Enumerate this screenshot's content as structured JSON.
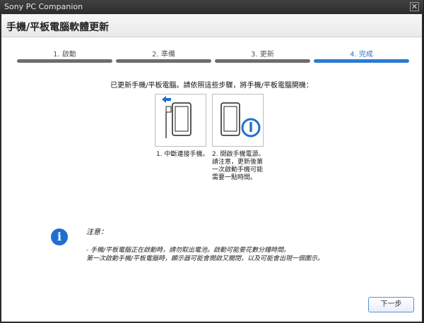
{
  "window": {
    "title": "Sony PC Companion",
    "close_label": "✕"
  },
  "header": {
    "title": "手機/平板電腦軟體更新"
  },
  "steps": [
    {
      "label": "1. 啟動",
      "state": "done"
    },
    {
      "label": "2. 準備",
      "state": "done"
    },
    {
      "label": "3. 更新",
      "state": "done"
    },
    {
      "label": "4. 完成",
      "state": "active"
    }
  ],
  "instruction": "已更新手機/平板電腦。請依照這些步驟，將手機/平板電腦開機：",
  "cards": [
    {
      "icon": "disconnect-cable-icon",
      "caption_lines": [
        "1. 中斷連接手機。"
      ]
    },
    {
      "icon": "power-on-icon",
      "caption_lines": [
        "2. 開啟手機電源。",
        "請注意，更新後第",
        "一次啟動手機可能",
        "需要一點時間。"
      ]
    }
  ],
  "note": {
    "icon": "info-icon",
    "title": "注意：",
    "lines": [
      "- 手機/平板電腦正在啟動時，請勿取出電池。啟動可能要花數分鐘時間。",
      "  第一次啟動手機/平板電腦時，顯示器可能會開啟又關閉，以及可能會出現一個圖示。"
    ]
  },
  "buttons": {
    "next": "下一步"
  },
  "colors": {
    "accent": "#2a7ad2",
    "inactive_step": "#6d6d6d"
  }
}
